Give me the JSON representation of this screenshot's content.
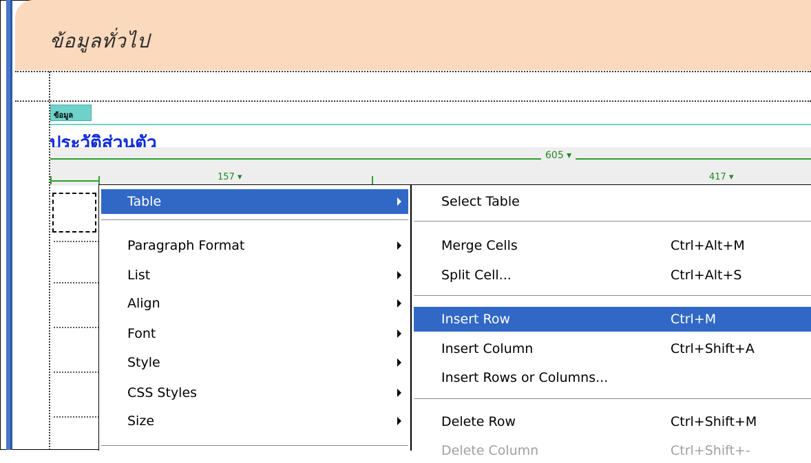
{
  "header": {
    "title": "ข้อมูลทั่วไป"
  },
  "content": {
    "info_tag": "ข้อมูล",
    "history_title": "ประวัติส่วนตัว"
  },
  "ruler": {
    "total_width_label": "605 ▾",
    "col1_label": "157 ▾",
    "col2_label": "417 ▾"
  },
  "context_menu": {
    "items": [
      {
        "label": "Table",
        "has_submenu": true,
        "highlighted": true
      },
      {
        "label": "Paragraph Format",
        "has_submenu": true
      },
      {
        "label": "List",
        "has_submenu": true
      },
      {
        "label": "Align",
        "has_submenu": true
      },
      {
        "label": "Font",
        "has_submenu": true
      },
      {
        "label": "Style",
        "has_submenu": true
      },
      {
        "label": "CSS Styles",
        "has_submenu": true
      },
      {
        "label": "Size",
        "has_submenu": true
      }
    ]
  },
  "table_submenu": {
    "items": [
      {
        "label": "Select Table",
        "shortcut": ""
      },
      {
        "label": "Merge Cells",
        "shortcut": "Ctrl+Alt+M"
      },
      {
        "label": "Split Cell...",
        "shortcut": "Ctrl+Alt+S"
      },
      {
        "label": "Insert Row",
        "shortcut": "Ctrl+M",
        "highlighted": true
      },
      {
        "label": "Insert Column",
        "shortcut": "Ctrl+Shift+A"
      },
      {
        "label": "Insert Rows or Columns...",
        "shortcut": ""
      },
      {
        "label": "Delete Row",
        "shortcut": "Ctrl+Shift+M"
      },
      {
        "label": "Delete Column",
        "shortcut": "Ctrl+Shift+-",
        "disabled": true
      }
    ]
  },
  "colors": {
    "header_bg": "#fbd9bd",
    "menu_highlight": "#3168c6",
    "ruler_green": "#2ca02c",
    "title_blue": "#0f2bd6",
    "tag_teal": "#6fd2ca"
  }
}
